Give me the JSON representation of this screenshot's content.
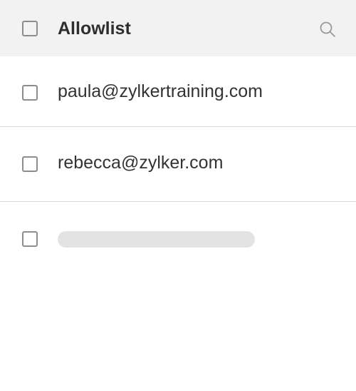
{
  "header": {
    "title": "Allowlist",
    "search_icon": "search-icon"
  },
  "rows": [
    {
      "email": "paula@zylkertraining.com"
    },
    {
      "email": "rebecca@zylker.com"
    },
    {
      "email": ""
    }
  ],
  "colors": {
    "header_bg": "#f2f2f2",
    "text": "#333333",
    "checkbox_border": "#8d8d8d",
    "divider": "#dadada",
    "skeleton": "#e3e3e3"
  }
}
